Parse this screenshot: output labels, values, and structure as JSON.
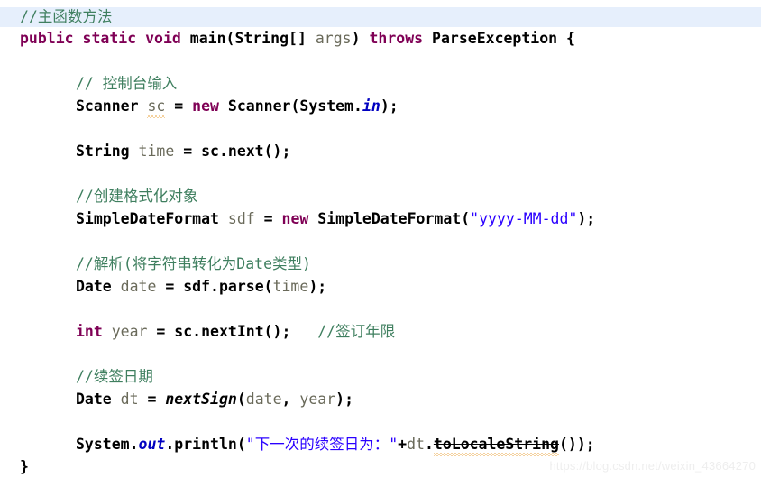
{
  "editor": {
    "language": "java",
    "current_line_index": 0,
    "highlight_color": "#e6effc",
    "background_color": "#ffffff",
    "colors": {
      "keyword": "#7f0055",
      "comment": "#3f7f5f",
      "string": "#2a00ff",
      "static_field": "#0000c0",
      "local_variable": "#6a6a5a",
      "warning_squiggle": "#e8a33d",
      "watermark": "#eeeeee"
    }
  },
  "code": {
    "l1_comment": "//主函数方法",
    "l2_public": "public",
    "l2_static": "static",
    "l2_void": "void",
    "l2_main": " main(String[] ",
    "l2_args": "args",
    "l2_paren": ") ",
    "l2_throws": "throws",
    "l2_tail": " ParseException {",
    "l4_comment": "// 控制台输入",
    "l5_type": "Scanner ",
    "l5_var": "sc",
    "l5_eq": " = ",
    "l5_new": "new",
    "l5_call": " Scanner(System.",
    "l5_in": "in",
    "l5_tail": ");",
    "l7_type": "String",
    "l7_var": " time",
    "l7_rest": " = sc.next();",
    "l9_comment": "//创建格式化对象",
    "l10_type": "SimpleDateFormat ",
    "l10_var": "sdf",
    "l10_eq": " = ",
    "l10_new": "new",
    "l10_call": " SimpleDateFormat(",
    "l10_str": "\"yyyy-MM-dd\"",
    "l10_tail": ");",
    "l12_comment": "//解析(将字符串转化为Date类型)",
    "l13_type": "Date",
    "l13_var": " date",
    "l13_rest": " = sdf.parse(",
    "l13_arg": "time",
    "l13_tail": ");",
    "l15_int": "int",
    "l15_var": " year",
    "l15_rest": " = sc.nextInt();",
    "l15_gap": "   ",
    "l15_comment": "//签订年限",
    "l17_comment": "//续签日期",
    "l18_type": "Date",
    "l18_var": " dt",
    "l18_eq": " = ",
    "l18_method": "nextSign",
    "l18_open": "(",
    "l18_arg1": "date",
    "l18_comma": ", ",
    "l18_arg2": "year",
    "l18_tail": ");",
    "l20_sys": "System.",
    "l20_out": "out",
    "l20_println": ".println(",
    "l20_str": "\"下一次的续签日为：\"",
    "l20_plus": "+",
    "l20_dt": "dt",
    "l20_dot": ".",
    "l20_method": "toLocaleString",
    "l20_tail": "());",
    "l21_close": "}"
  },
  "watermark": {
    "text": "https://blog.csdn.net/weixin_43664270"
  }
}
